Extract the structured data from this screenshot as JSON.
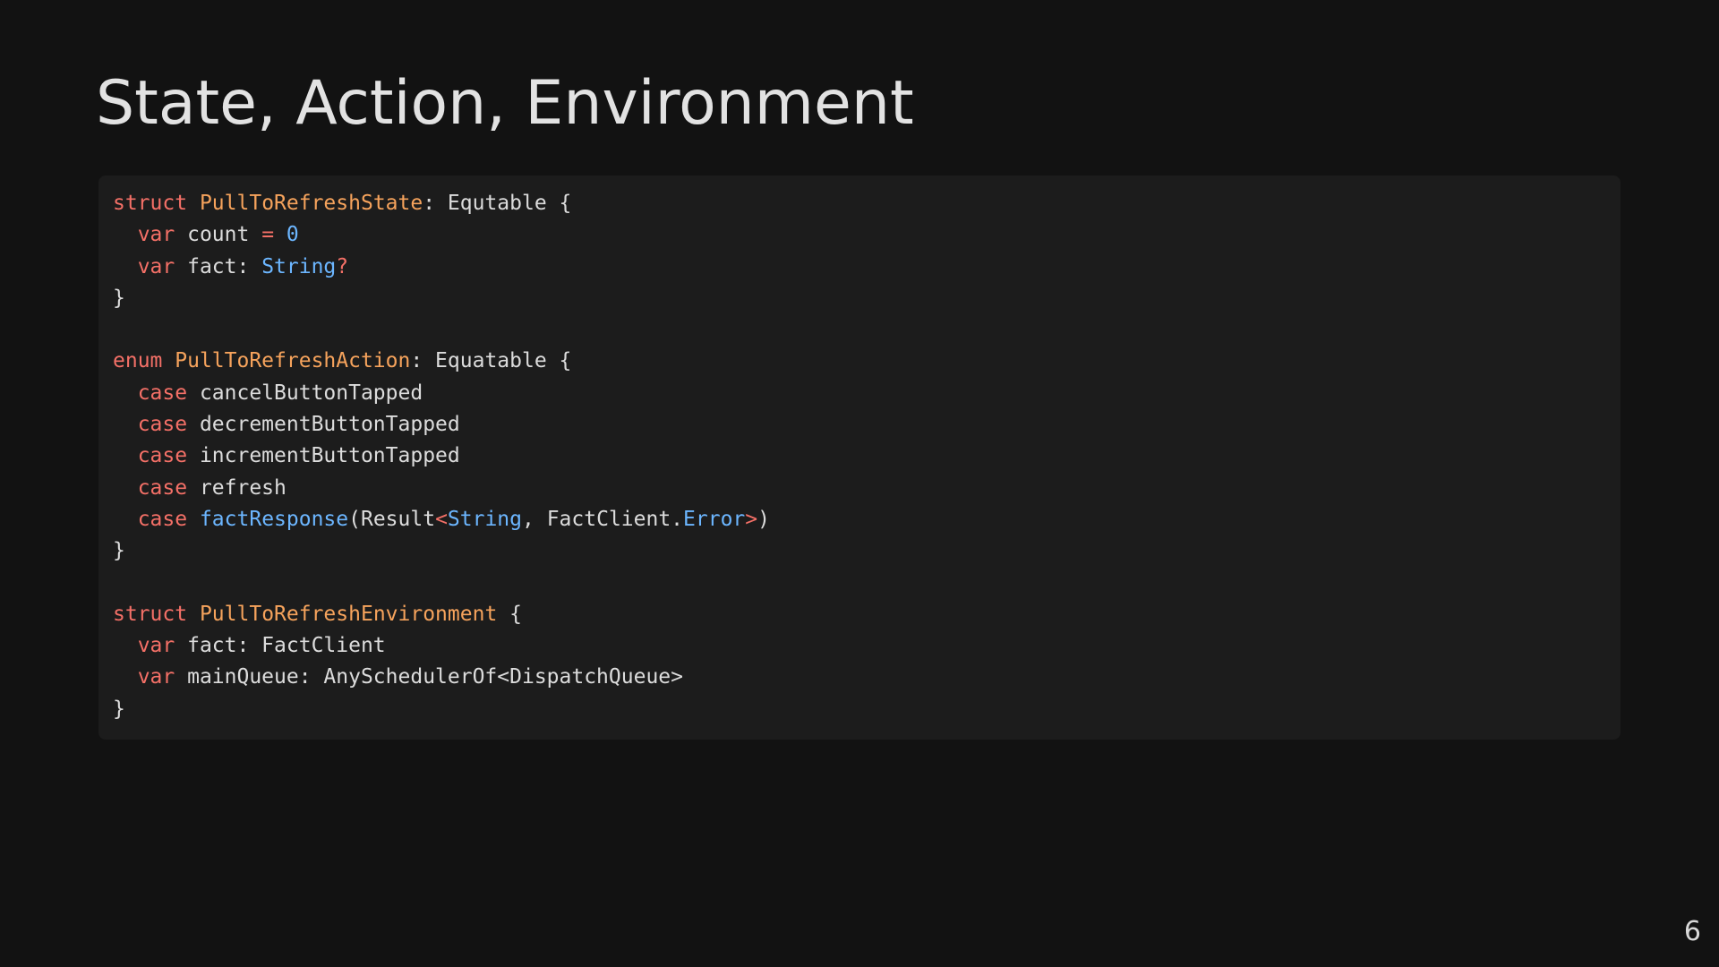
{
  "slide": {
    "title": "State, Action, Environment",
    "page_number": "6"
  },
  "colors": {
    "background": "#121212",
    "code_background": "#1c1c1c",
    "keyword": "#f47067",
    "type_name": "#f6a35c",
    "builtin_type": "#6cb6ff",
    "number": "#6cb6ff",
    "plain": "#dcdcdc"
  },
  "code": {
    "language": "swift",
    "lines": [
      [
        {
          "t": "struct",
          "k": "kw"
        },
        {
          "t": " ",
          "k": "plain"
        },
        {
          "t": "PullToRefreshState",
          "k": "type"
        },
        {
          "t": ": Equtable {",
          "k": "plain"
        }
      ],
      [
        {
          "t": "  ",
          "k": "plain"
        },
        {
          "t": "var",
          "k": "kw"
        },
        {
          "t": " count ",
          "k": "plain"
        },
        {
          "t": "=",
          "k": "op"
        },
        {
          "t": " ",
          "k": "plain"
        },
        {
          "t": "0",
          "k": "num"
        }
      ],
      [
        {
          "t": "  ",
          "k": "plain"
        },
        {
          "t": "var",
          "k": "kw"
        },
        {
          "t": " fact: ",
          "k": "plain"
        },
        {
          "t": "String",
          "k": "builtin"
        },
        {
          "t": "?",
          "k": "op"
        }
      ],
      [
        {
          "t": "}",
          "k": "plain"
        }
      ],
      [],
      [
        {
          "t": "enum",
          "k": "kw"
        },
        {
          "t": " ",
          "k": "plain"
        },
        {
          "t": "PullToRefreshAction",
          "k": "type"
        },
        {
          "t": ": Equatable {",
          "k": "plain"
        }
      ],
      [
        {
          "t": "  ",
          "k": "plain"
        },
        {
          "t": "case",
          "k": "kw"
        },
        {
          "t": " cancelButtonTapped",
          "k": "plain"
        }
      ],
      [
        {
          "t": "  ",
          "k": "plain"
        },
        {
          "t": "case",
          "k": "kw"
        },
        {
          "t": " decrementButtonTapped",
          "k": "plain"
        }
      ],
      [
        {
          "t": "  ",
          "k": "plain"
        },
        {
          "t": "case",
          "k": "kw"
        },
        {
          "t": " incrementButtonTapped",
          "k": "plain"
        }
      ],
      [
        {
          "t": "  ",
          "k": "plain"
        },
        {
          "t": "case",
          "k": "kw"
        },
        {
          "t": " refresh",
          "k": "plain"
        }
      ],
      [
        {
          "t": "  ",
          "k": "plain"
        },
        {
          "t": "case",
          "k": "kw"
        },
        {
          "t": " ",
          "k": "plain"
        },
        {
          "t": "factResponse",
          "k": "fn"
        },
        {
          "t": "(Result",
          "k": "plain"
        },
        {
          "t": "<",
          "k": "op"
        },
        {
          "t": "String",
          "k": "builtin"
        },
        {
          "t": ", FactClient.",
          "k": "plain"
        },
        {
          "t": "Error",
          "k": "builtin"
        },
        {
          "t": ">",
          "k": "op"
        },
        {
          "t": ")",
          "k": "plain"
        }
      ],
      [
        {
          "t": "}",
          "k": "plain"
        }
      ],
      [],
      [
        {
          "t": "struct",
          "k": "kw"
        },
        {
          "t": " ",
          "k": "plain"
        },
        {
          "t": "PullToRefreshEnvironment",
          "k": "type"
        },
        {
          "t": " {",
          "k": "plain"
        }
      ],
      [
        {
          "t": "  ",
          "k": "plain"
        },
        {
          "t": "var",
          "k": "kw"
        },
        {
          "t": " fact: FactClient",
          "k": "plain"
        }
      ],
      [
        {
          "t": "  ",
          "k": "plain"
        },
        {
          "t": "var",
          "k": "kw"
        },
        {
          "t": " mainQueue: AnySchedulerOf<DispatchQueue>",
          "k": "plain"
        }
      ],
      [
        {
          "t": "}",
          "k": "plain"
        }
      ]
    ]
  }
}
